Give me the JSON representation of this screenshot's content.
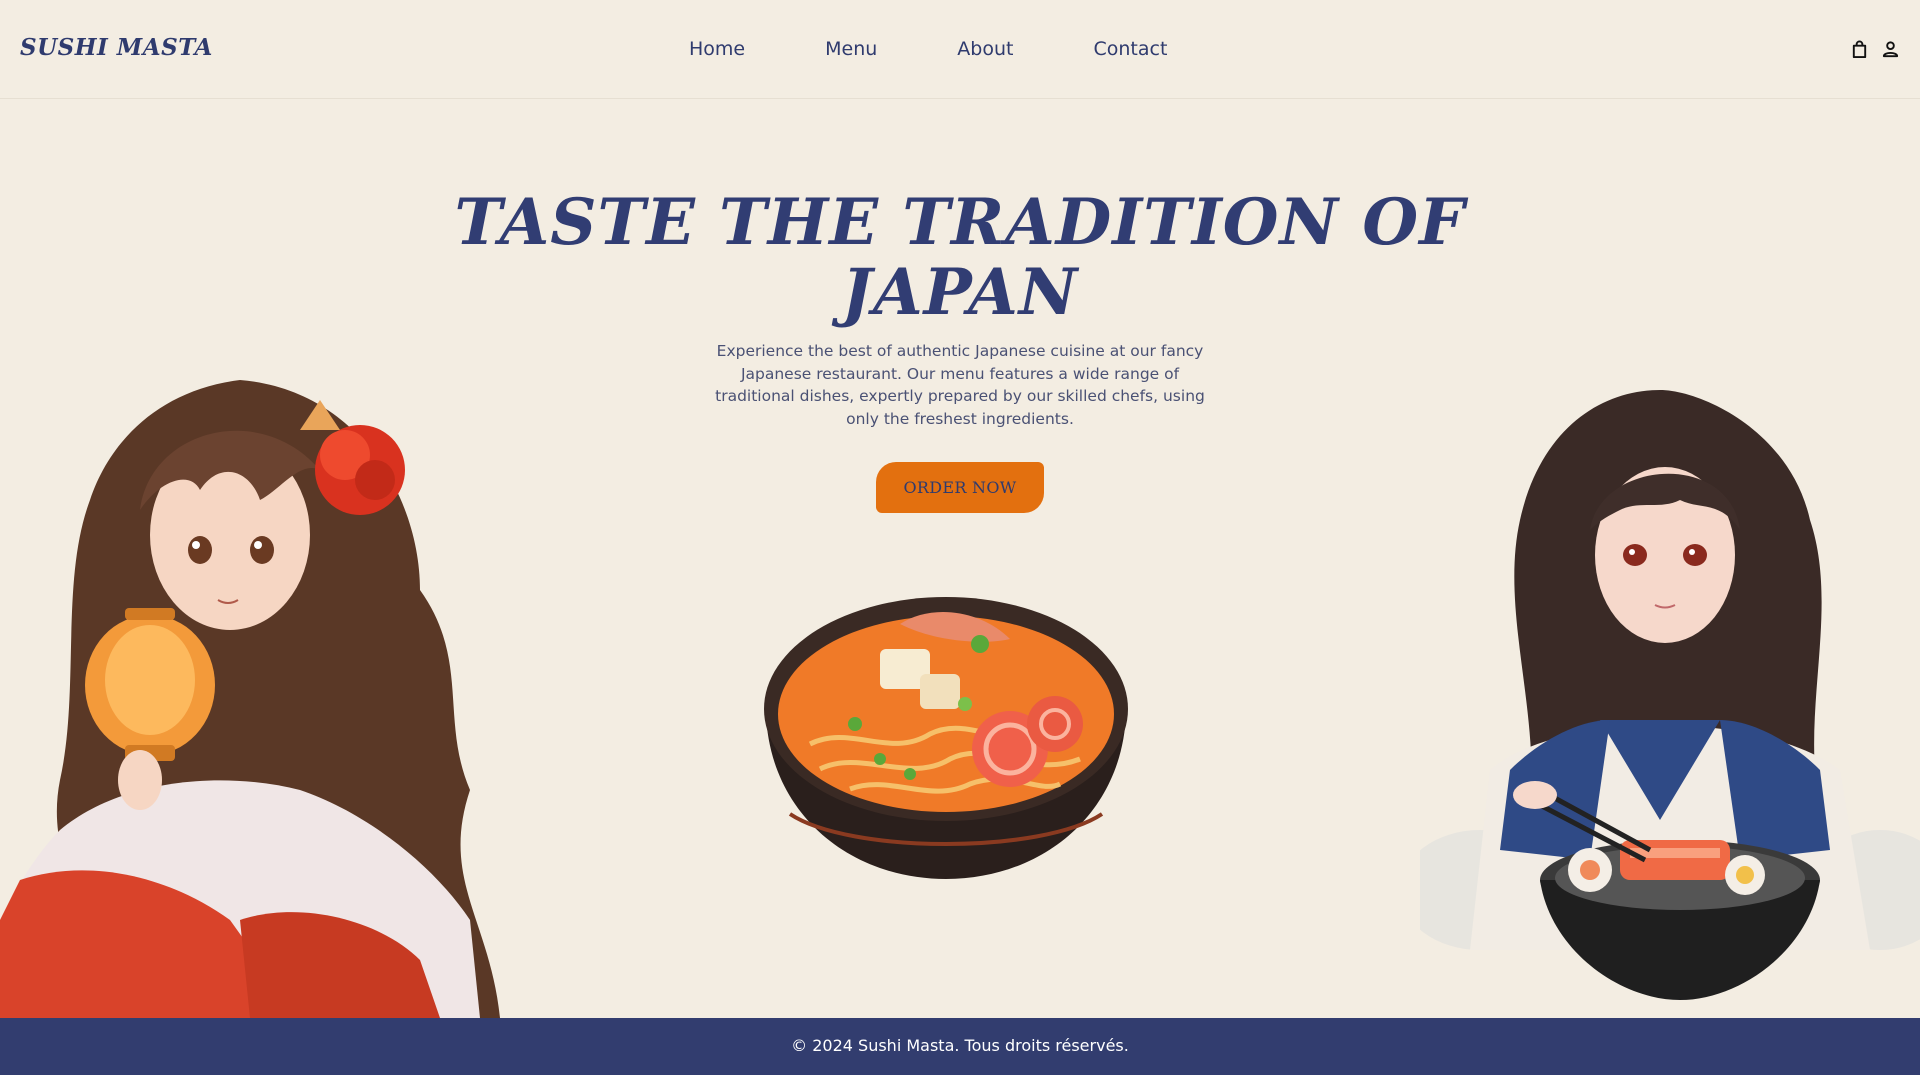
{
  "header": {
    "logo": "SUSHI MASTA",
    "nav": [
      {
        "label": "Home"
      },
      {
        "label": "Menu"
      },
      {
        "label": "About"
      },
      {
        "label": "Contact"
      }
    ],
    "icons": [
      "shopping-bag-icon",
      "user-icon"
    ]
  },
  "hero": {
    "title": "TASTE THE TRADITION OF JAPAN",
    "description": "Experience the best of authentic Japanese cuisine at our fancy Japanese restaurant. Our menu features a wide range of traditional dishes, expertly prepared by our skilled chefs, using only the freshest ingredients.",
    "cta_label": "ORDER NOW"
  },
  "footer": {
    "copyright": "© 2024 Sushi Masta. Tous droits réservés."
  },
  "colors": {
    "background": "#f3ede2",
    "primary": "#313d73",
    "accent": "#e3700f",
    "footer_bg": "#323d6f"
  }
}
